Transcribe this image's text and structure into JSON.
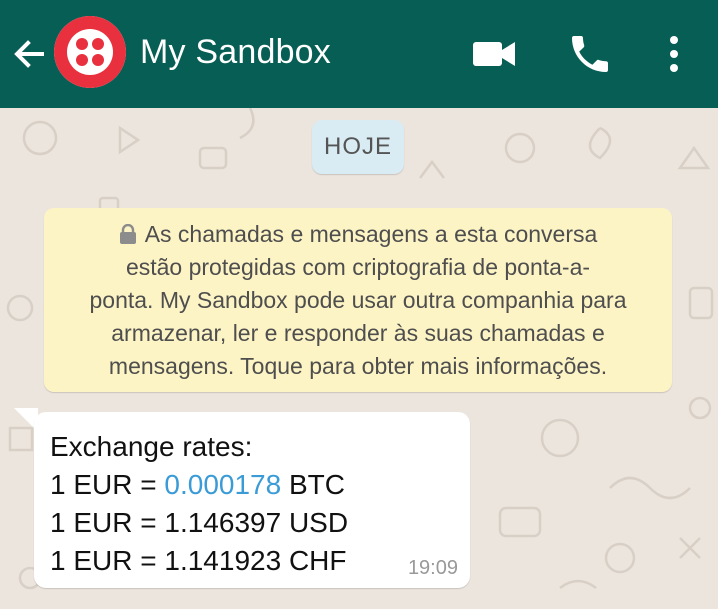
{
  "header": {
    "title": "My Sandbox",
    "icons": [
      "back-arrow-icon",
      "twilio-logo",
      "video-camera-icon",
      "phone-icon",
      "more-vert-icon"
    ],
    "colors": {
      "bar": "#075e54",
      "logo": "#e8303f"
    }
  },
  "chat": {
    "date_chip": "HOJE",
    "notice": {
      "lines": [
        "As chamadas e mensagens a esta conversa",
        "estão protegidas com criptografia de ponta-a-",
        "ponta. My Sandbox pode usar outra companhia para",
        "armazenar, ler e responder às suas chamadas e",
        "mensagens. Toque para obter mais informações."
      ]
    },
    "message": {
      "line1": "Exchange rates:",
      "line2_prefix": "1 EUR = ",
      "line2_link": "0.000178",
      "line2_suffix": " BTC",
      "line3": "1 EUR = 1.146397 USD",
      "line4": "1 EUR = 1.141923 CHF",
      "time": "19:09"
    }
  }
}
